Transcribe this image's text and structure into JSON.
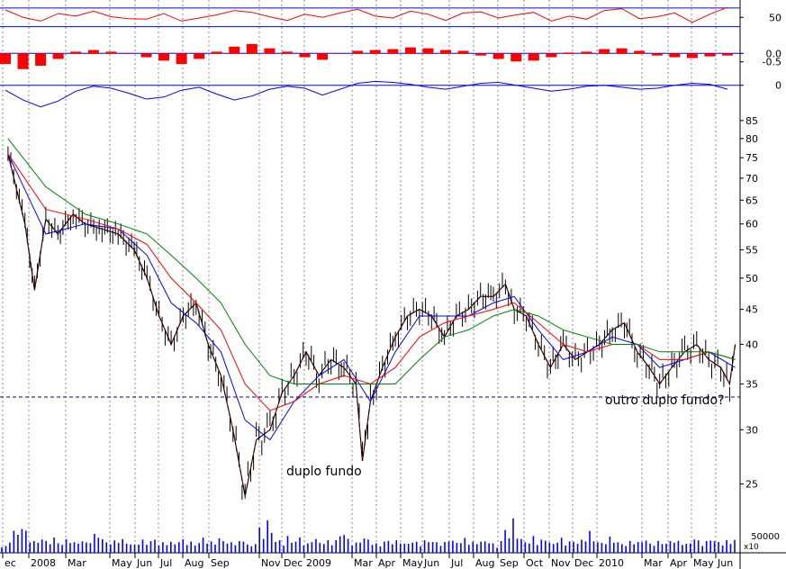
{
  "chart_data": {
    "type": "line",
    "title": "",
    "xlabel": "",
    "ylabel": "",
    "grid": true,
    "x_ticks": [
      "ec",
      "2008",
      "Mar",
      "May",
      "Jun",
      "Jul",
      "Aug",
      "Sep",
      "Nov",
      "Dec",
      "2009",
      "Mar",
      "Apr",
      "May",
      "Jun",
      "Jul",
      "Aug",
      "Sep",
      "Oct",
      "Nov",
      "Dec",
      "2010",
      "Mar",
      "Apr",
      "May",
      "Jun"
    ],
    "price_panel": {
      "scale": "log",
      "ylim": [
        23,
        86
      ],
      "y_ticks": [
        85,
        80,
        75,
        70,
        65,
        60,
        55,
        50,
        45,
        40,
        35,
        30,
        25
      ],
      "reference_level": 33.5,
      "annotations": [
        {
          "text": "duplo fundo",
          "x": "2009-03",
          "y": 26
        },
        {
          "text": "outro duplo fundo?",
          "x": "2010-06",
          "y": 32.5
        }
      ],
      "series": [
        {
          "name": "",
          "color": "#000000",
          "kind": "ohlc",
          "x": [
            "2007-12-20",
            "2008-01-10",
            "2008-01-22",
            "2008-02-05",
            "2008-02-20",
            "2008-03-10",
            "2008-03-25",
            "2008-04-15",
            "2008-05-05",
            "2008-05-25",
            "2008-06-10",
            "2008-06-25",
            "2008-07-10",
            "2008-07-25",
            "2008-08-10",
            "2008-08-25",
            "2008-09-10",
            "2008-09-25",
            "2008-10-10",
            "2008-10-24",
            "2008-11-10",
            "2008-11-25",
            "2008-12-10",
            "2008-12-25",
            "2009-01-10",
            "2009-01-25",
            "2009-02-10",
            "2009-02-25",
            "2009-03-05",
            "2009-03-15",
            "2009-03-30",
            "2009-04-15",
            "2009-04-30",
            "2009-05-15",
            "2009-05-30",
            "2009-06-15",
            "2009-06-30",
            "2009-07-15",
            "2009-07-30",
            "2009-08-15",
            "2009-08-30",
            "2009-09-10",
            "2009-09-25",
            "2009-10-10",
            "2009-10-25",
            "2009-11-10",
            "2009-11-25",
            "2009-12-10",
            "2009-12-25",
            "2010-01-10",
            "2010-01-25",
            "2010-02-10",
            "2010-02-25",
            "2010-03-10",
            "2010-03-25",
            "2010-04-10",
            "2010-04-25",
            "2010-05-10",
            "2010-05-25",
            "2010-06-05",
            "2010-06-12"
          ],
          "close": [
            76,
            60,
            48,
            61,
            58,
            62,
            60,
            59,
            58,
            55,
            50,
            44,
            40,
            44,
            46,
            40,
            36,
            30,
            24,
            29,
            30,
            34,
            36,
            39,
            36,
            38,
            37,
            35,
            27,
            33,
            37,
            41,
            44,
            45,
            44,
            41,
            44,
            45,
            47,
            47,
            49,
            45,
            44,
            40,
            37,
            40,
            38,
            39,
            40,
            42,
            43,
            39,
            37,
            35,
            37,
            39,
            40,
            38,
            37,
            35,
            40
          ]
        },
        {
          "name": "",
          "color": "#0000ff",
          "kind": "moving-average",
          "x": [
            "2007-12-20",
            "2008-02-05",
            "2008-03-25",
            "2008-05-05",
            "2008-06-10",
            "2008-07-10",
            "2008-08-10",
            "2008-09-10",
            "2008-10-10",
            "2008-11-10",
            "2008-12-10",
            "2009-01-10",
            "2009-02-10",
            "2009-03-15",
            "2009-04-15",
            "2009-05-15",
            "2009-06-15",
            "2009-07-15",
            "2009-08-15",
            "2009-09-10",
            "2009-10-10",
            "2009-11-10",
            "2009-12-10",
            "2010-01-10",
            "2010-02-10",
            "2010-03-10",
            "2010-04-10",
            "2010-05-10",
            "2010-06-12"
          ],
          "values": [
            76,
            58,
            60,
            59,
            54,
            46,
            43,
            39,
            31,
            29,
            33,
            36,
            38,
            33,
            39,
            44,
            44,
            44,
            46,
            47,
            42,
            38,
            39,
            41,
            40,
            37,
            38,
            39,
            37
          ]
        },
        {
          "name": "",
          "color": "#ff0000",
          "kind": "moving-average",
          "x": [
            "2007-12-20",
            "2008-02-05",
            "2008-03-25",
            "2008-05-05",
            "2008-06-10",
            "2008-07-10",
            "2008-08-10",
            "2008-09-10",
            "2008-10-10",
            "2008-11-10",
            "2008-12-10",
            "2009-01-10",
            "2009-02-10",
            "2009-03-15",
            "2009-04-15",
            "2009-05-15",
            "2009-06-15",
            "2009-07-15",
            "2009-08-15",
            "2009-09-10",
            "2009-10-10",
            "2009-11-10",
            "2009-12-10",
            "2010-01-10",
            "2010-02-10",
            "2010-03-10",
            "2010-04-10",
            "2010-05-10",
            "2010-06-12"
          ],
          "values": [
            76,
            63,
            61,
            59,
            56,
            50,
            46,
            42,
            35,
            32,
            33,
            35,
            36,
            35,
            37,
            41,
            43,
            44,
            45,
            46,
            43,
            40,
            39,
            40,
            40,
            38,
            38,
            39,
            38
          ]
        },
        {
          "name": "",
          "color": "#008000",
          "kind": "moving-average",
          "x": [
            "2007-12-20",
            "2008-02-05",
            "2008-03-25",
            "2008-05-05",
            "2008-06-10",
            "2008-07-10",
            "2008-08-10",
            "2008-09-10",
            "2008-10-10",
            "2008-11-10",
            "2008-12-10",
            "2009-01-10",
            "2009-02-10",
            "2009-03-15",
            "2009-04-15",
            "2009-05-15",
            "2009-06-15",
            "2009-07-15",
            "2009-08-15",
            "2009-09-10",
            "2009-10-10",
            "2009-11-10",
            "2009-12-10",
            "2010-01-10",
            "2010-02-10",
            "2010-03-10",
            "2010-04-10",
            "2010-05-10",
            "2010-06-12"
          ],
          "values": [
            80,
            68,
            62,
            60,
            58,
            54,
            50,
            46,
            40,
            36,
            35,
            35,
            35,
            35,
            35,
            38,
            41,
            42,
            44,
            45,
            44,
            42,
            41,
            40,
            40,
            39,
            39,
            39,
            38
          ]
        }
      ]
    },
    "indicator_panels": [
      {
        "y_ticks": [
          50
        ],
        "reference_lines": [
          65,
          35
        ],
        "ylim": [
          20,
          75
        ],
        "color": "#ff0000",
        "kind": "line",
        "values": [
          62,
          50,
          44,
          56,
          52,
          60,
          51,
          48,
          47,
          56,
          44,
          49,
          54,
          61,
          58,
          51,
          45,
          55,
          50,
          57,
          63,
          52,
          49,
          60,
          55,
          45,
          57,
          59,
          49,
          54,
          58,
          44,
          52,
          47,
          61,
          64,
          48,
          51,
          57,
          42,
          55,
          66
        ]
      },
      {
        "y_ticks": [
          0.0,
          -0.5
        ],
        "reference_lines": [
          0
        ],
        "ylim": [
          -1.1,
          0.6
        ],
        "color": "#ff0000",
        "kind": "histogram",
        "values": [
          -0.6,
          -0.9,
          -0.7,
          -0.3,
          0.1,
          0.2,
          0.1,
          0.0,
          -0.2,
          -0.4,
          -0.6,
          -0.3,
          0.1,
          0.4,
          0.55,
          0.3,
          0.1,
          -0.2,
          -0.35,
          0.0,
          0.15,
          0.2,
          0.25,
          0.35,
          0.3,
          0.2,
          0.15,
          -0.1,
          -0.3,
          -0.45,
          -0.4,
          -0.2,
          0.05,
          0.1,
          0.25,
          0.3,
          0.15,
          -0.1,
          -0.2,
          -0.25,
          -0.15,
          -0.1
        ]
      },
      {
        "y_ticks": [
          0
        ],
        "reference_lines": [
          0
        ],
        "ylim": [
          -25,
          8
        ],
        "color": "#0000ff",
        "kind": "line",
        "values": [
          -5,
          -15,
          -22,
          -16,
          -6,
          -1,
          -3,
          -8,
          -14,
          -12,
          -5,
          -2,
          -9,
          -15,
          -11,
          -4,
          -1,
          -3,
          -10,
          -4,
          2,
          4,
          3,
          1,
          -2,
          -4,
          -1,
          2,
          3,
          0,
          -3,
          -6,
          -4,
          -1,
          0,
          -2,
          -4,
          -3,
          0,
          2,
          1,
          -4
        ]
      }
    ],
    "volume_panel": {
      "y_ticks": [
        "50000"
      ],
      "multiplier_label": "x10",
      "color": "#0000ff",
      "kind": "bar",
      "values": [
        30,
        22,
        40,
        80,
        60,
        110,
        70,
        45,
        40,
        35,
        55,
        38,
        42,
        50,
        36,
        30,
        44,
        48,
        34,
        38,
        40,
        35,
        42,
        60,
        70,
        45,
        38,
        33,
        40,
        52,
        44,
        36,
        30,
        28,
        38,
        42,
        35,
        40,
        46,
        30,
        34,
        38,
        36,
        32,
        40,
        44,
        38,
        36,
        30,
        34,
        52,
        40,
        36,
        38,
        48,
        42,
        36,
        34,
        40,
        38,
        44
      ]
    }
  }
}
